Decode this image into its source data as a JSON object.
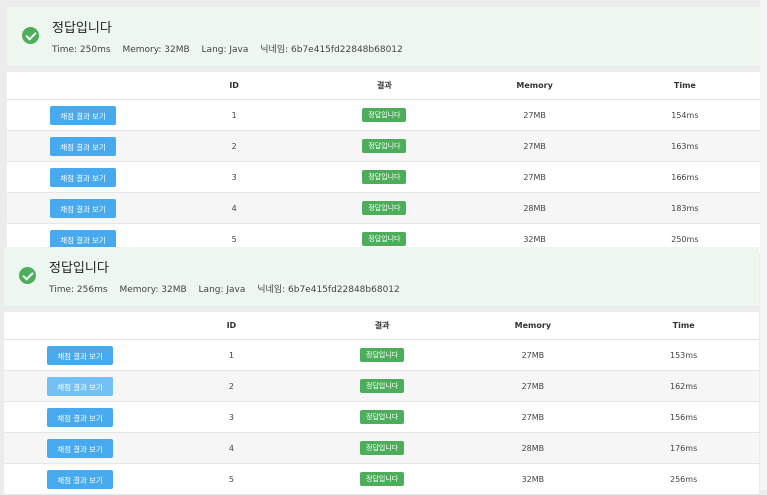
{
  "panels": [
    {
      "title": "정답입니다",
      "time": "Time: 250ms",
      "memory": "Memory: 32MB",
      "lang": "Lang: Java",
      "nickname": "닉네임: 6b7e415fd22848b68012",
      "headers": {
        "id": "ID",
        "result": "결과",
        "memory": "Memory",
        "time": "Time"
      },
      "rows": [
        {
          "button": "채점 결과 보기",
          "id": "1",
          "result": "정답입니다",
          "memory": "27MB",
          "time": "154ms"
        },
        {
          "button": "채점 결과 보기",
          "id": "2",
          "result": "정답입니다",
          "memory": "27MB",
          "time": "163ms"
        },
        {
          "button": "채점 결과 보기",
          "id": "3",
          "result": "정답입니다",
          "memory": "27MB",
          "time": "166ms"
        },
        {
          "button": "채점 결과 보기",
          "id": "4",
          "result": "정답입니다",
          "memory": "28MB",
          "time": "183ms"
        },
        {
          "button": "채점 결과 보기",
          "id": "5",
          "result": "정답입니다",
          "memory": "32MB",
          "time": "250ms"
        }
      ]
    },
    {
      "title": "정답입니다",
      "time": "Time: 256ms",
      "memory": "Memory: 32MB",
      "lang": "Lang: Java",
      "nickname": "닉네임: 6b7e415fd22848b68012",
      "headers": {
        "id": "ID",
        "result": "결과",
        "memory": "Memory",
        "time": "Time"
      },
      "rows": [
        {
          "button": "채점 결과 보기",
          "id": "1",
          "result": "정답입니다",
          "memory": "27MB",
          "time": "153ms"
        },
        {
          "button": "채점 결과 보기",
          "id": "2",
          "result": "정답입니다",
          "memory": "27MB",
          "time": "162ms"
        },
        {
          "button": "채점 결과 보기",
          "id": "3",
          "result": "정답입니다",
          "memory": "27MB",
          "time": "156ms"
        },
        {
          "button": "채점 결과 보기",
          "id": "4",
          "result": "정답입니다",
          "memory": "28MB",
          "time": "176ms"
        },
        {
          "button": "채점 결과 보기",
          "id": "5",
          "result": "정답입니다",
          "memory": "32MB",
          "time": "256ms"
        }
      ]
    }
  ],
  "colors": {
    "success": "#4cae5b",
    "button": "#47a9ee",
    "banner": "#eef7ef"
  },
  "icons": {
    "status": "check-circle-icon"
  }
}
